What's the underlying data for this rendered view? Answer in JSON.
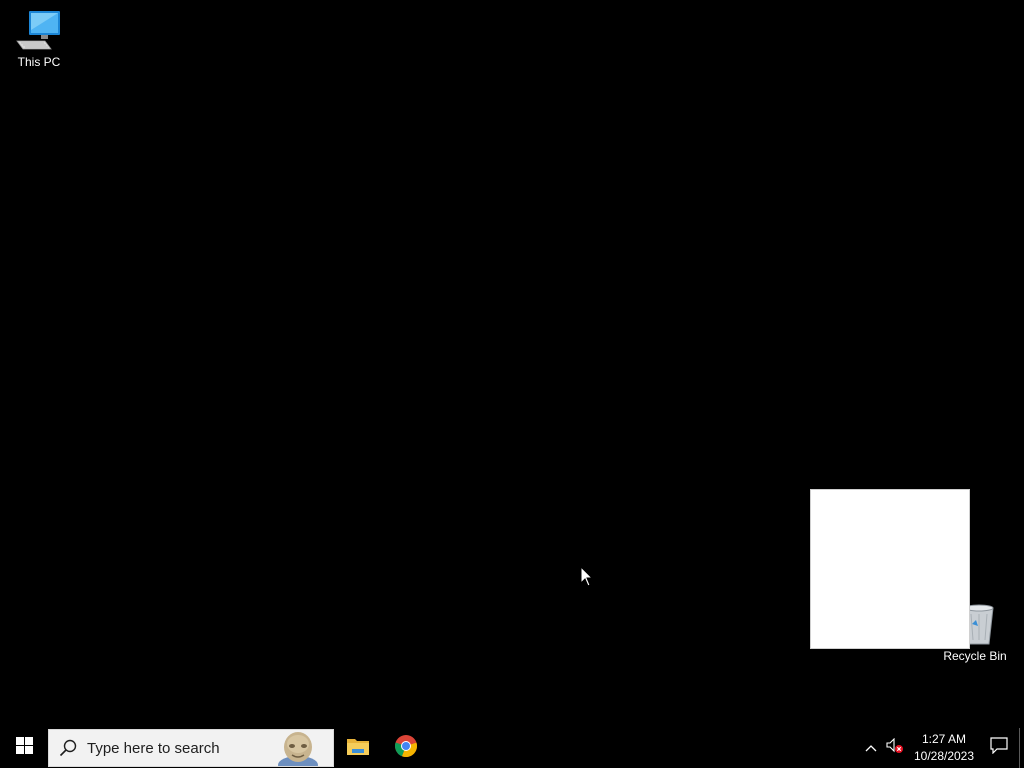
{
  "desktop": {
    "background_color": "#000000",
    "icons": [
      {
        "label": "This PC",
        "icon": "this-pc-icon"
      },
      {
        "label": "Recycle Bin",
        "icon": "recycle-bin-icon"
      }
    ],
    "blank_window_color": "#ffffff"
  },
  "taskbar": {
    "background_color": "#000000",
    "start_icon": "windows-logo-icon",
    "search": {
      "placeholder": "Type here to search",
      "icon": "search-icon"
    },
    "pinned_apps": [
      {
        "name": "File Explorer",
        "icon": "file-explorer-icon"
      },
      {
        "name": "Google Chrome",
        "icon": "chrome-icon"
      }
    ],
    "tray": {
      "icons": [
        "chevron-up-icon",
        "volume-muted-icon"
      ],
      "time": "1:27 AM",
      "date": "10/28/2023",
      "notification_icon": "notification-icon"
    }
  }
}
